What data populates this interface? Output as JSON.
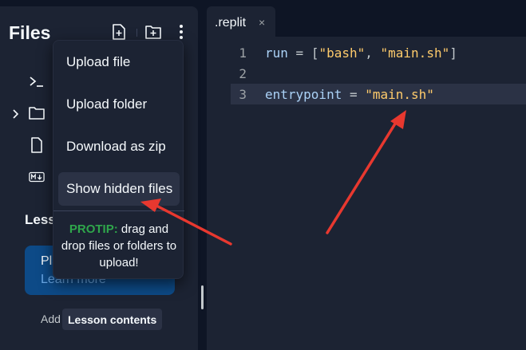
{
  "sidebar": {
    "title": "Files",
    "lesson_heading": "Lesson",
    "play_card": {
      "title": "Play",
      "subtitle": "Learn more"
    },
    "add_text": "Add",
    "lesson_chip": "Lesson contents"
  },
  "menu": {
    "items": [
      {
        "label": "Upload file"
      },
      {
        "label": "Upload folder"
      },
      {
        "label": "Download as zip"
      },
      {
        "label": "Show hidden files"
      }
    ],
    "protip_label": "PROTIP:",
    "protip_text": " drag and drop files or folders to upload!"
  },
  "editor": {
    "tab_label": ".replit",
    "tab_close": "×",
    "lines": [
      {
        "num": "1",
        "key": "run",
        "op": " = ",
        "open": "[",
        "s1": "\"bash\"",
        "sep": ", ",
        "s2": "\"main.sh\"",
        "close": "]"
      },
      {
        "num": "2"
      },
      {
        "num": "3",
        "key": "entrypoint",
        "op": " = ",
        "s1": "\"main.sh\""
      }
    ]
  },
  "colors": {
    "background": "#0e1525",
    "panel": "#1c2333",
    "highlight": "#2b3245",
    "protip_green": "#2fa64b",
    "string_orange": "#ffcb6b",
    "arrow_red": "#e8382f"
  }
}
